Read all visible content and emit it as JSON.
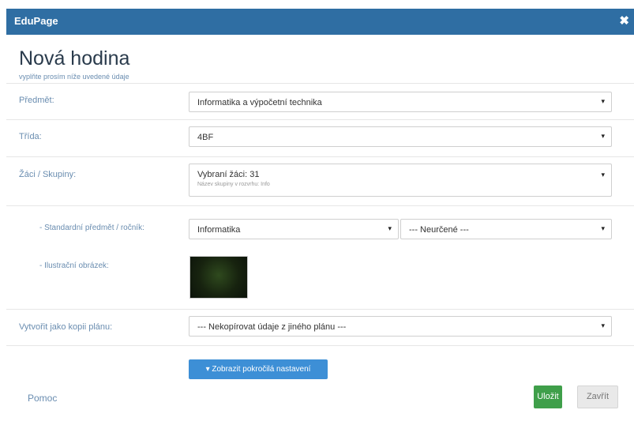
{
  "window": {
    "app_name": "EduPage",
    "close_glyph": "✖"
  },
  "dialog": {
    "title": "Nová hodina",
    "subtitle": "vyplňte prosím níže uvedené údaje"
  },
  "form": {
    "subject": {
      "label": "Předmět:",
      "value": "Informatika a výpočetní technika"
    },
    "class": {
      "label": "Třída:",
      "value": "4BF"
    },
    "students": {
      "label": "Žáci / Skupiny:",
      "value": "Vybraní žáci: 31",
      "hint": "Název skupiny v rozvrhu: Info"
    },
    "standard_subject": {
      "label": "- Standardní předmět / ročník:",
      "subject_value": "Informatika",
      "grade_value": "--- Neurčené ---"
    },
    "illustration": {
      "label": "- Ilustrační obrázek:",
      "thumbnail": "dark-green-texture"
    },
    "copy_plan": {
      "label": "Vytvořit jako kopii plánu:",
      "value": "--- Nekopírovat údaje z jiného plánu ---"
    }
  },
  "advanced_button": {
    "label": "▾ Zobrazit pokročilá nastavení"
  },
  "footer": {
    "help_link": "Pomoc",
    "save_label": "Uložit",
    "close_label": "Zavřít"
  },
  "icons": {
    "dropdown": "▾",
    "close": "close-icon"
  },
  "colors": {
    "titlebar": "#2f6ea3",
    "primary": "#3d8fd6",
    "success": "#3f9f4a",
    "label": "#6a8db0"
  }
}
